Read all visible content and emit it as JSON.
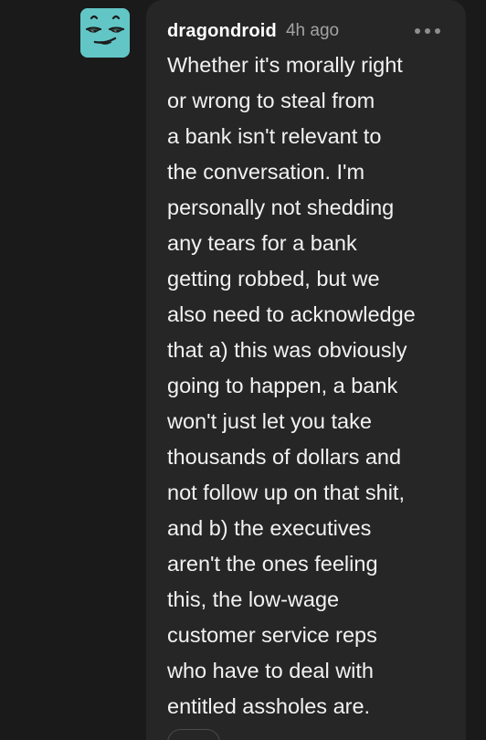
{
  "comment": {
    "username": "dragondroid",
    "timestamp": "4h ago",
    "avatar_icon": "smug-face-avatar",
    "more_icon": "ellipsis-icon",
    "body_lines": [
      "Whether it's morally right",
      "or wrong to steal from",
      "a bank isn't relevant to",
      "the conversation. I'm",
      "personally not shedding",
      "any tears for a bank",
      "getting robbed, but we",
      "also need to acknowledge",
      "that a) this was obviously",
      "going to happen, a bank",
      "won't just let you take",
      "thousands of dollars and",
      "not follow up on that shit,",
      "and b) the executives",
      "aren't the ones feeling",
      "this, the low-wage",
      "customer service reps",
      "who have to deal with",
      "entitled assholes are."
    ]
  },
  "colors": {
    "background": "#1a1a1a",
    "bubble": "#262626",
    "avatar": "#62c6c6",
    "text": "#f2f2f2",
    "muted": "#a3a3a3"
  }
}
